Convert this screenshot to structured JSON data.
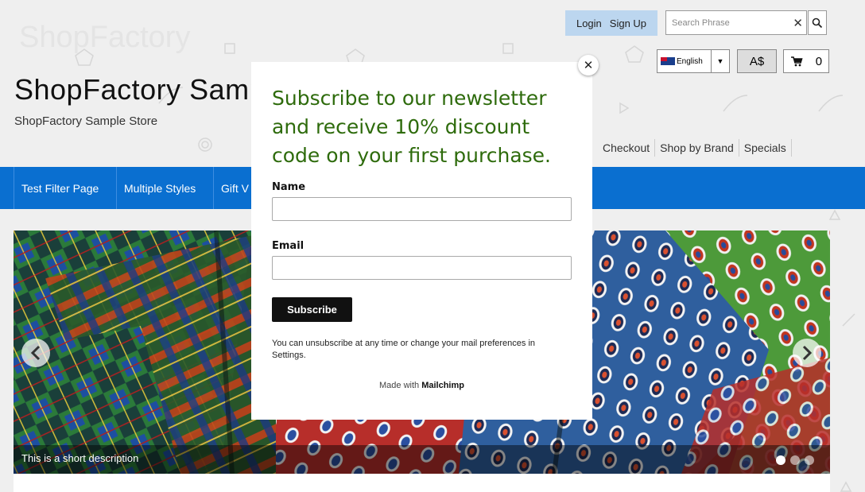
{
  "header": {
    "watermark_logo": "ShopFactory",
    "store_title": "ShopFactory Sample Store",
    "store_subtitle": "ShopFactory Sample Store"
  },
  "account": {
    "login_label": "Login",
    "signup_label": "Sign Up"
  },
  "search": {
    "placeholder": "Search Phrase",
    "clear_icon": "close-icon",
    "button_icon": "search-icon"
  },
  "language": {
    "selected": "English",
    "flag_icon": "australia-flag-icon"
  },
  "currency": {
    "selected": "A$"
  },
  "cart": {
    "icon": "cart-icon",
    "count": "0"
  },
  "top_links": [
    "Checkout",
    "Shop by Brand",
    "Specials"
  ],
  "navbar": {
    "background": "#0a6fd0",
    "items": [
      "Test Filter Page",
      "Multiple Styles",
      "Gift V"
    ]
  },
  "slider": {
    "caption": "This is a short description",
    "prev_icon": "chevron-left-icon",
    "next_icon": "chevron-right-icon",
    "slide_count": 3,
    "active_index": 0
  },
  "newsletter_popup": {
    "heading": "Subscribe to our newsletter and receive 10% discount code on your first purchase.",
    "heading_color": "#2e6b0c",
    "name_label": "Name",
    "name_value": "",
    "email_label": "Email",
    "email_value": "",
    "subscribe_label": "Subscribe",
    "fineprint": "You can unsubscribe at any time or change your mail preferences in Settings.",
    "made_with_prefix": "Made with",
    "made_with_brand": "Mailchimp",
    "close_icon": "close-icon"
  }
}
